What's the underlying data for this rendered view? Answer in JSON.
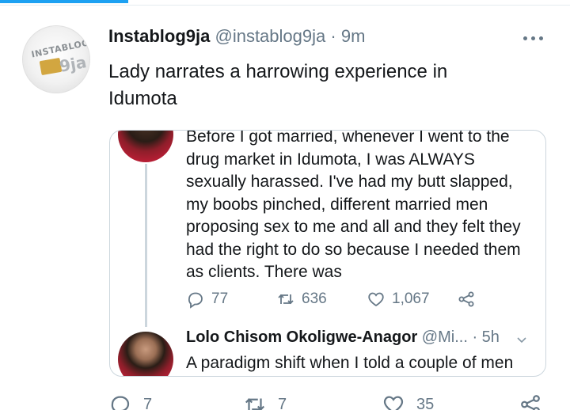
{
  "tweet": {
    "author_name": "Instablog9ja",
    "handle": "@instablog9ja",
    "separator": "·",
    "time": "9m",
    "text_line1": "Lady narrates a harrowing experience in",
    "text_line2": "Idumota",
    "avatar_logo_top": "INSTABLOG",
    "avatar_logo_bottom": "9ja"
  },
  "quote": {
    "lines": [
      "Before I got married, whenever I went to the",
      "drug market in Idumota, I was ALWAYS",
      "sexually harassed. I've had my butt slapped,",
      "my boobs pinched, different married men",
      "proposing sex to me and all and they felt they",
      "had the right to do so because I needed them",
      "as clients. There was"
    ],
    "actions": {
      "replies": "77",
      "retweets": "636",
      "likes": "1,067"
    },
    "reply": {
      "name": "Lolo Chisom Okoligwe-Anagor",
      "handle": "@Mi...",
      "separator": "·",
      "time": "5h",
      "text": "A paradigm shift when I told a couple of men"
    }
  },
  "bottom_actions": {
    "replies": "7",
    "retweets": "7",
    "likes": "35"
  },
  "icons": {
    "more": "more-dots-icon",
    "reply": "reply-bubble-icon",
    "retweet": "retweet-icon",
    "like": "heart-icon",
    "share": "share-icon",
    "chevron": "chevron-down-icon"
  },
  "colors": {
    "accent": "#1da1f2",
    "text": "#14171a",
    "muted": "#657786",
    "border": "#ccd6dd"
  }
}
